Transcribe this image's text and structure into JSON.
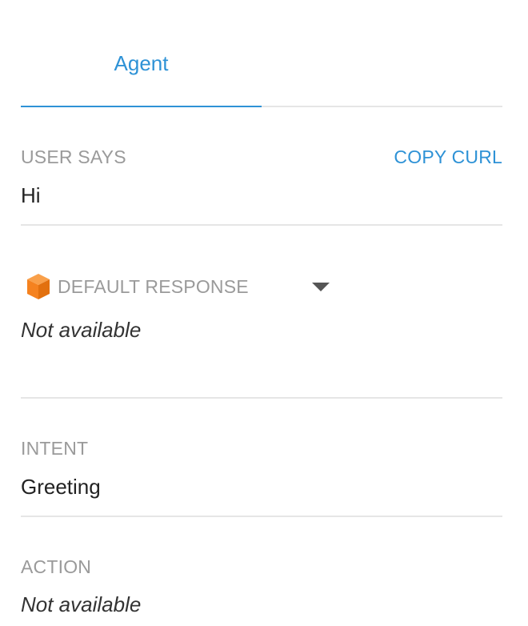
{
  "tabs": {
    "agent_label": "Agent"
  },
  "user_says": {
    "label": "USER SAYS",
    "copy_curl_label": "COPY CURL",
    "value": "Hi"
  },
  "default_response": {
    "icon": "orange-cube-icon",
    "label": "DEFAULT RESPONSE",
    "value": "Not available"
  },
  "intent": {
    "label": "INTENT",
    "value": "Greeting"
  },
  "action": {
    "label": "ACTION",
    "value": "Not available"
  },
  "colors": {
    "accent": "#2e92d6",
    "muted": "#9a9a9a",
    "divider": "#e6e6e6",
    "cube": "#f5821f"
  }
}
